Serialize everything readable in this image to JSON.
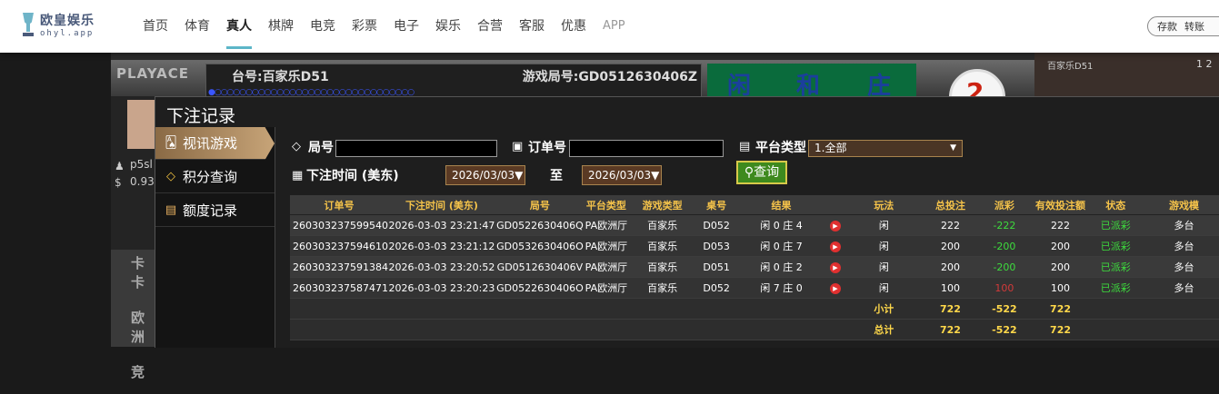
{
  "topbar": {
    "logo_name": "欧皇娱乐",
    "logo_sub": "ohyl.app",
    "nav": [
      "首页",
      "体育",
      "真人",
      "棋牌",
      "电竞",
      "彩票",
      "电子",
      "娱乐",
      "合营",
      "客服",
      "优惠",
      "APP"
    ],
    "active_nav": "真人",
    "account_links": [
      "存款",
      "转账"
    ]
  },
  "background": {
    "provider_logo": "PLAYACE",
    "table_label": "台号:百家乐D51",
    "game_round": "游戏局号:GD0512630406Z",
    "card_labels": [
      "闲",
      "和",
      "庄"
    ],
    "ball_number": "2",
    "right_label": "百家乐D51",
    "right_number": "1 2",
    "user_short": "p5sl",
    "balance_short": "0.93",
    "left_menu": [
      "卡卡",
      "欧洲",
      "竞"
    ]
  },
  "modal": {
    "title": "下注记录",
    "sidebar": [
      {
        "label": "视讯游戏",
        "icon": "cards-icon",
        "active": true
      },
      {
        "label": "积分查询",
        "icon": "diamond-icon",
        "active": false
      },
      {
        "label": "额度记录",
        "icon": "document-icon",
        "active": false
      }
    ],
    "filters": {
      "round_label": "局号",
      "round_value": "",
      "order_label": "订单号",
      "order_value": "",
      "platform_label": "平台类型",
      "platform_value": "1.全部",
      "time_label": "下注时间 (美东)",
      "date_from": "2026/03/03",
      "to_label": "至",
      "date_to": "2026/03/03",
      "query_button": "查询"
    },
    "table": {
      "headers": [
        "订单号",
        "下注时间 (美东)",
        "局号",
        "平台类型",
        "游戏类型",
        "桌号",
        "结果",
        "",
        "玩法",
        "总投注",
        "派彩",
        "有效投注额",
        "状态",
        "游戏模"
      ],
      "rows": [
        {
          "order": "260303237599540",
          "time": "2026-03-03 23:21:47",
          "round": "GD0522630406Q",
          "platform": "PA欧洲厅",
          "game": "百家乐",
          "desk": "D052",
          "result": "闲 0 庄 4",
          "play": "闲",
          "bet": "222",
          "payout": "-222",
          "valid": "222",
          "status": "已派彩",
          "mode": "多台"
        },
        {
          "order": "260303237594610",
          "time": "2026-03-03 23:21:12",
          "round": "GD0532630406O",
          "platform": "PA欧洲厅",
          "game": "百家乐",
          "desk": "D053",
          "result": "闲 0 庄 7",
          "play": "闲",
          "bet": "200",
          "payout": "-200",
          "valid": "200",
          "status": "已派彩",
          "mode": "多台"
        },
        {
          "order": "260303237591384",
          "time": "2026-03-03 23:20:52",
          "round": "GD0512630406V",
          "platform": "PA欧洲厅",
          "game": "百家乐",
          "desk": "D051",
          "result": "闲 0 庄 2",
          "play": "闲",
          "bet": "200",
          "payout": "-200",
          "valid": "200",
          "status": "已派彩",
          "mode": "多台"
        },
        {
          "order": "260303237587471",
          "time": "2026-03-03 23:20:23",
          "round": "GD0522630406O",
          "platform": "PA欧洲厅",
          "game": "百家乐",
          "desk": "D052",
          "result": "闲 7 庄 0",
          "play": "闲",
          "bet": "100",
          "payout": "100",
          "valid": "100",
          "status": "已派彩",
          "mode": "多台"
        }
      ],
      "subtotal": {
        "label": "小计",
        "bet": "722",
        "payout": "-522",
        "valid": "722"
      },
      "total": {
        "label": "总计",
        "bet": "722",
        "payout": "-522",
        "valid": "722"
      }
    }
  },
  "colors": {
    "header_text": "#f5c34a",
    "accent_gold": "#c7a478",
    "negative": "#3ddc3d",
    "positive": "#d23a3a",
    "query_button": "#3e8a1e"
  }
}
